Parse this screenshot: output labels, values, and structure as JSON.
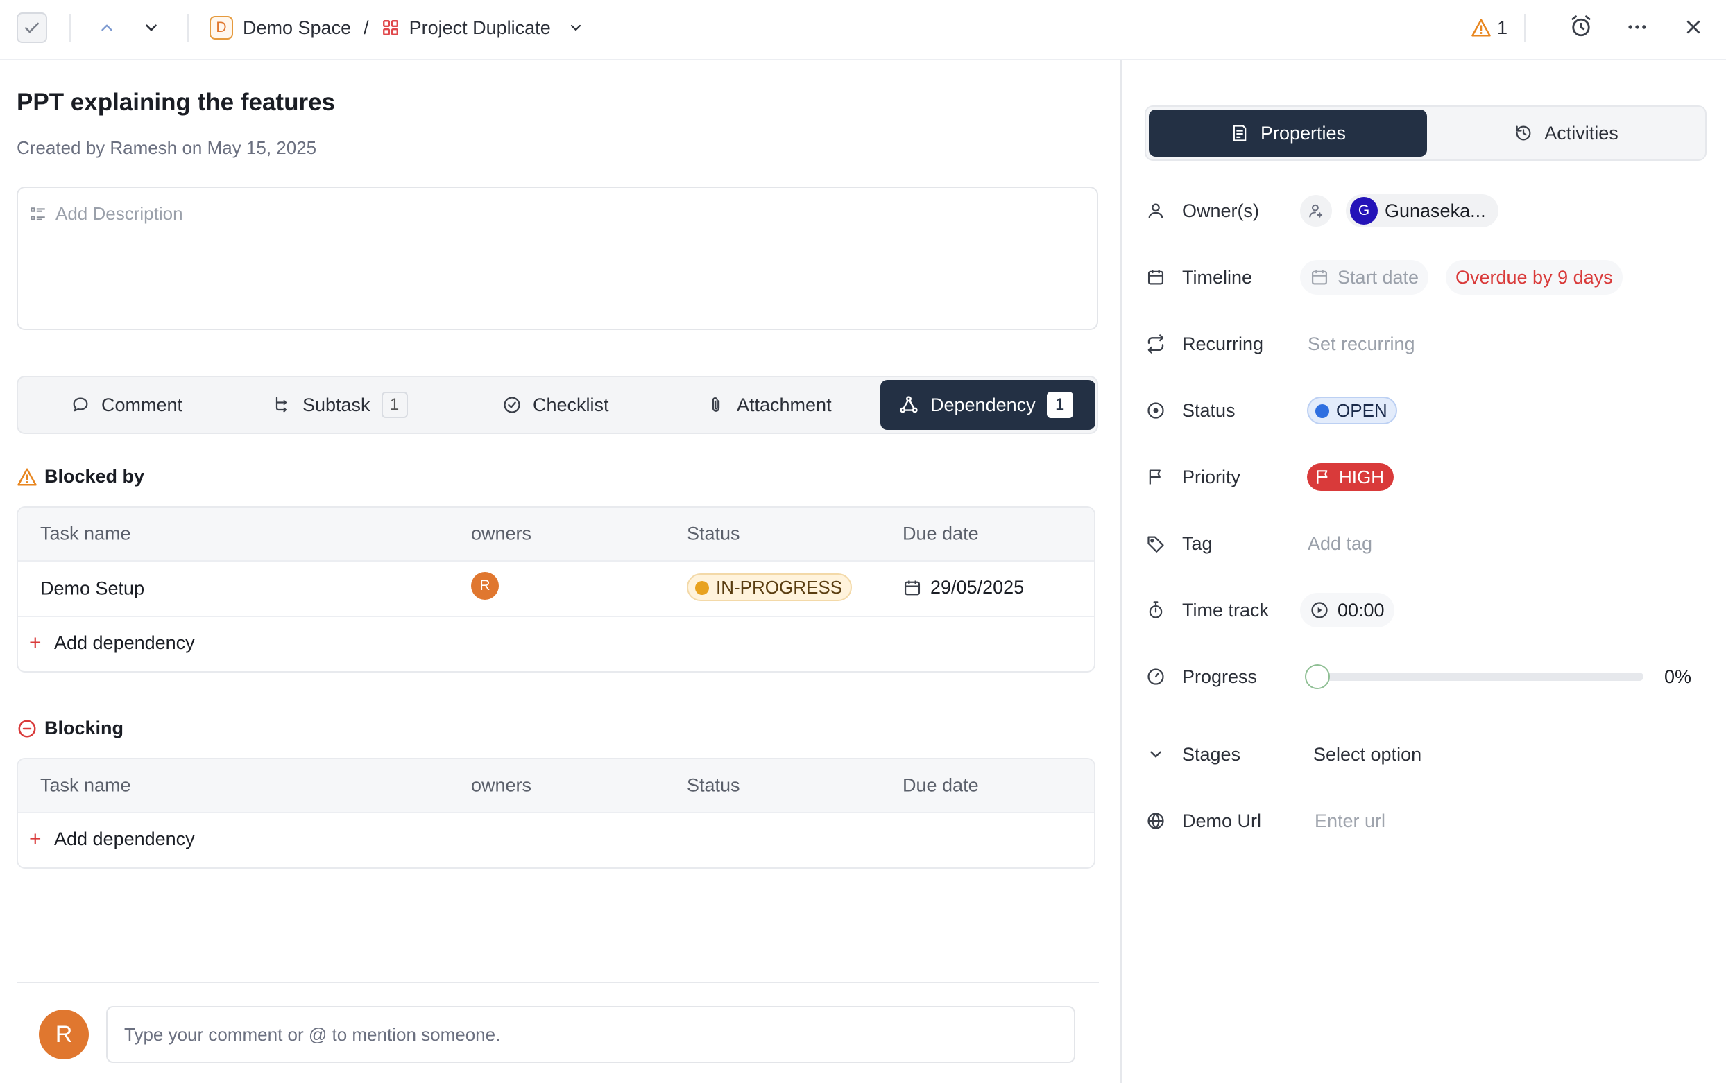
{
  "topbar": {
    "space_initial": "D",
    "space_name": "Demo Space",
    "separator": "/",
    "project_name": "Project Duplicate",
    "warning_count": "1"
  },
  "task": {
    "title": "PPT explaining the features",
    "created_by": "Created by Ramesh on May 15, 2025",
    "description_placeholder": "Add Description"
  },
  "tabs": [
    {
      "label": "Comment",
      "icon": "comment-icon"
    },
    {
      "label": "Subtask",
      "count": "1",
      "icon": "subtask-icon"
    },
    {
      "label": "Checklist",
      "icon": "checklist-icon"
    },
    {
      "label": "Attachment",
      "icon": "paperclip-icon"
    },
    {
      "label": "Dependency",
      "count": "1",
      "icon": "dependency-icon",
      "active": true
    }
  ],
  "blocked_by": {
    "title": "Blocked by",
    "columns": [
      "Task name",
      "owners",
      "Status",
      "Due date"
    ],
    "rows": [
      {
        "name": "Demo Setup",
        "owner_initial": "R",
        "status": "IN-PROGRESS",
        "due": "29/05/2025"
      }
    ],
    "add_label": "Add dependency"
  },
  "blocking": {
    "title": "Blocking",
    "columns": [
      "Task name",
      "owners",
      "Status",
      "Due date"
    ],
    "add_label": "Add dependency"
  },
  "comment": {
    "avatar_initial": "R",
    "placeholder": "Type your comment or @ to mention someone."
  },
  "panel": {
    "tabs": [
      "Properties",
      "Activities"
    ],
    "owners_label": "Owner(s)",
    "owner_initial": "G",
    "owner_name": "Gunaseka...",
    "timeline_label": "Timeline",
    "start_date": "Start date",
    "overdue": "Overdue by 9 days",
    "recurring_label": "Recurring",
    "recurring_value": "Set recurring",
    "status_label": "Status",
    "status_value": "OPEN",
    "priority_label": "Priority",
    "priority_value": "HIGH",
    "tag_label": "Tag",
    "tag_value": "Add tag",
    "timetrack_label": "Time track",
    "timetrack_value": "00:00",
    "progress_label": "Progress",
    "progress_value": "0%",
    "progress_fraction": 0,
    "stages_label": "Stages",
    "stages_value": "Select option",
    "url_label": "Demo Url",
    "url_placeholder": "Enter url"
  },
  "colors": {
    "dark": "#233044",
    "orange": "#e0772f",
    "red": "#d93a3a",
    "blue": "#2f6fe0",
    "owner_avatar": "#2413b8"
  }
}
